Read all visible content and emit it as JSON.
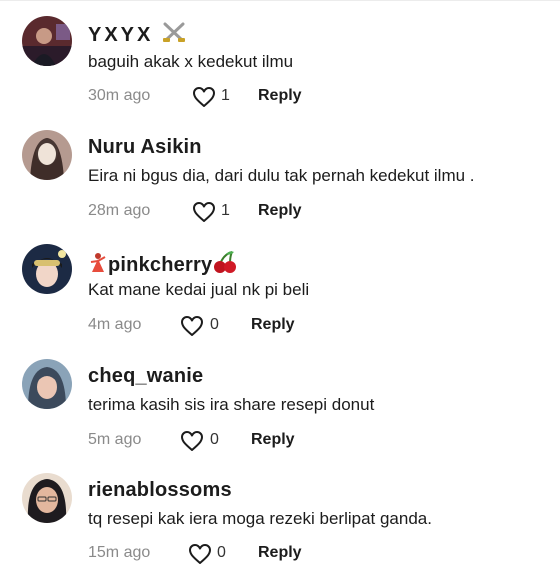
{
  "comments": [
    {
      "username": "YXYX",
      "badge_icon": "crossed-swords-emoji",
      "text": "baguih akak x kedekut ilmu",
      "time": "30m ago",
      "likes": "1",
      "reply_label": "Reply"
    },
    {
      "username": "Nuru Asikin",
      "text": "Eira ni bgus dia, dari dulu tak pernah kedekut ilmu .",
      "time": "28m ago",
      "likes": "1",
      "reply_label": "Reply"
    },
    {
      "username": "pinkcherry",
      "prefix_icon": "dancer-emoji",
      "suffix_icon": "cherries-emoji",
      "text": "Kat mane kedai jual nk pi beli",
      "time": "4m ago",
      "likes": "0",
      "reply_label": "Reply"
    },
    {
      "username": "cheq_wanie",
      "text": "terima kasih sis ira share resepi donut",
      "time": "5m ago",
      "likes": "0",
      "reply_label": "Reply"
    },
    {
      "username": "rienablossoms",
      "text": "tq resepi kak iera moga rezeki berlipat ganda.",
      "time": "15m ago",
      "likes": "0",
      "reply_label": "Reply"
    }
  ],
  "icons": {
    "like": "heart-outline-icon"
  },
  "colors": {
    "text": "#1c1c1c",
    "muted": "#8a8a8a"
  }
}
